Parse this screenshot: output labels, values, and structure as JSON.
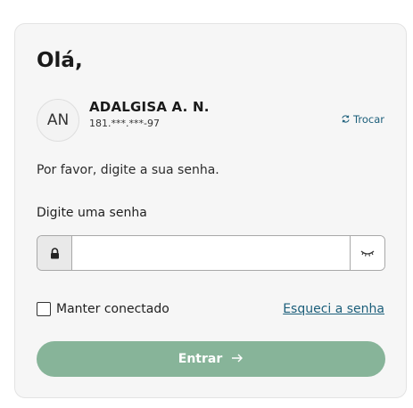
{
  "login": {
    "greeting": "Olá,",
    "user": {
      "initials": "AN",
      "name": "ADALGISA A. N.",
      "document": "181.***.***-97"
    },
    "swap_label": "Trocar",
    "instruction": "Por favor, digite a sua senha.",
    "password_label": "Digite uma senha",
    "password_value": "",
    "remember_label": "Manter conectado",
    "remember_checked": false,
    "forgot_label": "Esqueci a senha",
    "submit_label": "Entrar",
    "icons": {
      "swap": "swap-icon",
      "lock": "lock-icon",
      "eye": "eye-closed-icon",
      "arrow": "arrow-right-icon"
    },
    "colors": {
      "accent": "#87b499",
      "link": "#1b5e7a"
    }
  }
}
